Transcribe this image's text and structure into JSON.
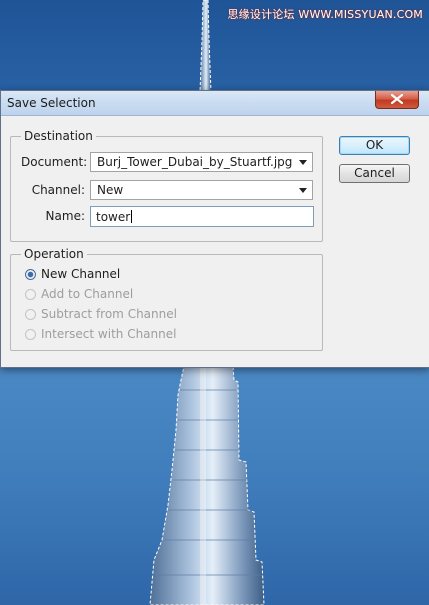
{
  "watermark": "思缘设计论坛 WWW.MISSYUAN.COM",
  "dialog": {
    "title": "Save Selection",
    "destination": {
      "group_label": "Destination",
      "document_label": "Document:",
      "document_value": "Burj_Tower_Dubai_by_Stuartf.jpg",
      "channel_label": "Channel:",
      "channel_value": "New",
      "name_label": "Name:",
      "name_value": "tower"
    },
    "operation": {
      "group_label": "Operation",
      "options": [
        {
          "label": "New Channel",
          "selected": true,
          "enabled": true
        },
        {
          "label": "Add to Channel",
          "selected": false,
          "enabled": false
        },
        {
          "label": "Subtract from Channel",
          "selected": false,
          "enabled": false
        },
        {
          "label": "Intersect with Channel",
          "selected": false,
          "enabled": false
        }
      ]
    },
    "buttons": {
      "ok": "OK",
      "cancel": "Cancel"
    }
  },
  "colors": {
    "sky": "#2a63a7",
    "dialog_bg": "#f0f0f0",
    "close_button": "#c13a22",
    "default_button_border": "#3c7fb1"
  }
}
